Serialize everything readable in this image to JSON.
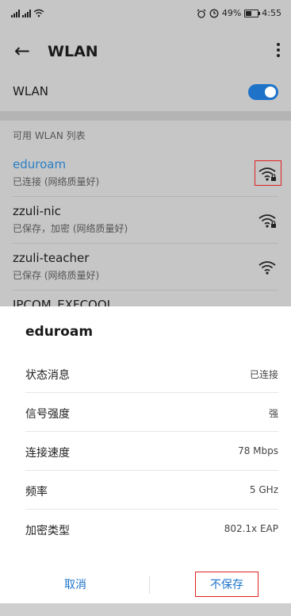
{
  "statusbar": {
    "left_text": "⁴⁶ ⁴⁶",
    "battery": "49%",
    "time": "4:55",
    "icons_right": [
      "alarm-icon",
      "clock-icon"
    ]
  },
  "titlebar": {
    "back_glyph": "←",
    "title": "WLAN",
    "more_icon": "more-vertical-icon"
  },
  "wlan_toggle": {
    "label": "WLAN",
    "state": "on",
    "accent": "#1e73c9"
  },
  "list": {
    "section_title": "可用 WLAN 列表",
    "networks": [
      {
        "name": "eduroam",
        "status": "已连接 (网络质量好)",
        "highlight": true,
        "name_color": "#2a7fc7"
      },
      {
        "name": "zzuli-nic",
        "status": "已保存，加密 (网络质量好)"
      },
      {
        "name": "zzuli-teacher",
        "status": "已保存 (网络质量好)"
      },
      {
        "name": "IPCOM_EXFCOOL",
        "status": ""
      }
    ]
  },
  "dialog": {
    "title": "eduroam",
    "rows": [
      {
        "key": "状态消息",
        "value": "已连接"
      },
      {
        "key": "信号强度",
        "value": "强"
      },
      {
        "key": "连接速度",
        "value": "78 Mbps"
      },
      {
        "key": "频率",
        "value": "5 GHz"
      },
      {
        "key": "加密类型",
        "value": "802.1x EAP"
      }
    ],
    "cancel_label": "取消",
    "forget_label": "不保存"
  },
  "colors": {
    "accent": "#1e73c9",
    "highlight_box": "#dd2222"
  }
}
